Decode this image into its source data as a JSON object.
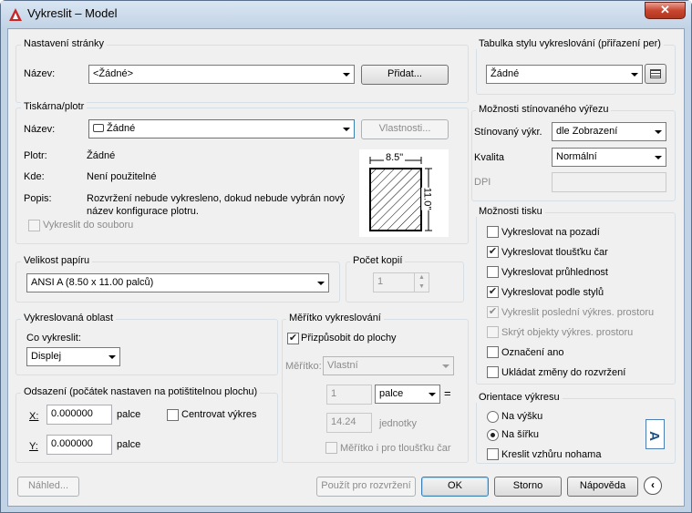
{
  "window": {
    "title": "Vykreslit – Model",
    "close": "✕"
  },
  "page_setup": {
    "title": "Nastavení stránky",
    "name_label": "Název:",
    "name_value": "<Žádné>",
    "add_button": "Přidat..."
  },
  "plotter": {
    "title": "Tiskárna/plotr",
    "name_label": "Název:",
    "name_value": "Žádné",
    "properties_button": "Vlastnosti...",
    "plotter_label": "Plotr:",
    "plotter_value": "Žádné",
    "where_label": "Kde:",
    "where_value": "Není použitelné",
    "description_label": "Popis:",
    "description_line1": "Rozvržení nebude vykresleno, dokud nebude vybrán nový",
    "description_line2": "název konfigurace plotru.",
    "plot_to_file": "Vykreslit do souboru",
    "preview_width": "8.5\"",
    "preview_height": "11.0\""
  },
  "paper_size": {
    "title": "Velikost papíru",
    "value": "ANSI A (8.50 x 11.00 palců)"
  },
  "copies": {
    "title": "Počet kopií",
    "value": "1"
  },
  "plot_area": {
    "title": "Vykreslovaná oblast",
    "what_label": "Co vykreslit:",
    "what_value": "Displej"
  },
  "plot_offset": {
    "title": "Odsazení (počátek nastaven na potištitelnou plochu)",
    "x_label": "X:",
    "x_value": "0.000000",
    "x_unit": "palce",
    "y_label": "Y:",
    "y_value": "0.000000",
    "y_unit": "palce",
    "center_label": "Centrovat výkres"
  },
  "plot_scale": {
    "title": "Měřítko vykreslování",
    "fit_label": "Přizpůsobit do plochy",
    "scale_label": "Měřítko:",
    "scale_value": "Vlastní",
    "value1": "1",
    "unit": "palce",
    "equals": "=",
    "value2": "14.24",
    "unit2": "jednotky",
    "lineweights_label": "Měřítko i pro tloušťku čar"
  },
  "plot_style_table": {
    "title": "Tabulka stylu vykreslování (přiřazení per)",
    "value": "Žádné"
  },
  "shaded_viewport": {
    "title": "Možnosti stínovaného výřezu",
    "shade_label": "Stínovaný výkr.",
    "shade_value": "dle Zobrazení",
    "quality_label": "Kvalita",
    "quality_value": "Normální",
    "dpi_label": "DPI"
  },
  "plot_options": {
    "title": "Možnosti tisku",
    "items": [
      {
        "label": "Vykreslovat na pozadí",
        "checked": false,
        "disabled": false
      },
      {
        "label": "Vykreslovat tloušťku čar",
        "checked": true,
        "disabled": false
      },
      {
        "label": "Vykreslovat průhlednost",
        "checked": false,
        "disabled": false
      },
      {
        "label": "Vykreslovat podle stylů",
        "checked": true,
        "disabled": false
      },
      {
        "label": "Vykreslit poslední výkres. prostoru",
        "checked": true,
        "disabled": true
      },
      {
        "label": "Skrýt objekty výkres. prostoru",
        "checked": false,
        "disabled": true
      },
      {
        "label": "Označení ano",
        "checked": false,
        "disabled": false
      },
      {
        "label": "Ukládat změny do rozvržení",
        "checked": false,
        "disabled": false
      }
    ]
  },
  "orientation": {
    "title": "Orientace výkresu",
    "portrait": "Na výšku",
    "landscape": "Na šířku",
    "upside_down": "Kreslit vzhůru nohama",
    "selected": "landscape",
    "icon_letter": "A"
  },
  "footer": {
    "preview": "Náhled...",
    "apply": "Použít pro rozvržení",
    "ok": "OK",
    "cancel": "Storno",
    "help": "Nápověda"
  },
  "colors": {
    "accent": "#3c7fb1",
    "title_red": "#c0392b",
    "disabled_text": "#8b8b8b"
  }
}
